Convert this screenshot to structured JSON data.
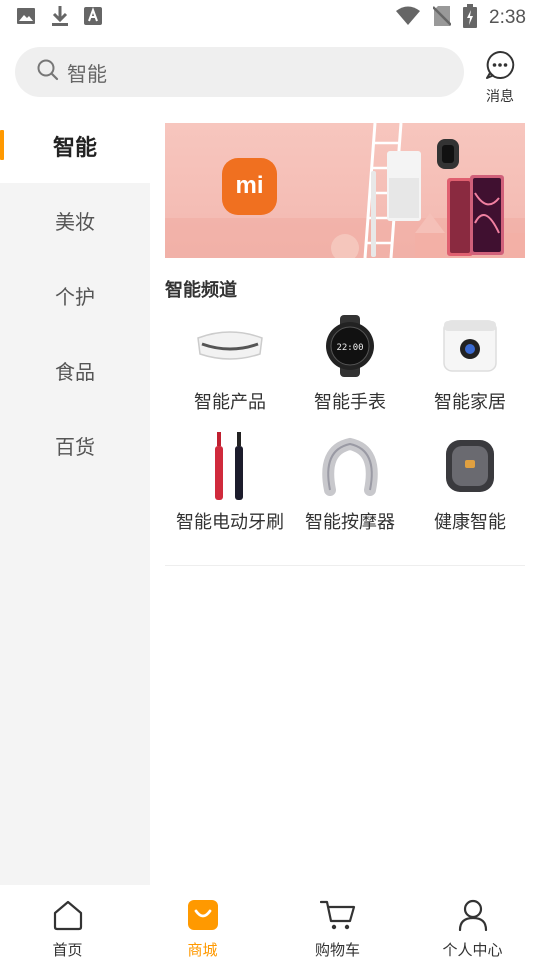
{
  "status_bar": {
    "time": "2:38",
    "icons": [
      "image-icon",
      "download-icon",
      "font-icon",
      "wifi-icon",
      "no-sim-icon",
      "battery-icon"
    ]
  },
  "header": {
    "search_text": "智能",
    "message_label": "消息"
  },
  "sidebar": {
    "items": [
      {
        "label": "智能",
        "active": true
      },
      {
        "label": "美妆",
        "active": false
      },
      {
        "label": "个护",
        "active": false
      },
      {
        "label": "食品",
        "active": false
      },
      {
        "label": "百货",
        "active": false
      }
    ]
  },
  "main": {
    "banner_logo_text": "mi",
    "section_title": "智能频道",
    "products": [
      {
        "label": "智能产品",
        "icon": "eye-massager-icon"
      },
      {
        "label": "智能手表",
        "icon": "smartwatch-icon"
      },
      {
        "label": "智能家居",
        "icon": "smart-cooker-icon"
      },
      {
        "label": "智能电动牙刷",
        "icon": "electric-toothbrush-icon"
      },
      {
        "label": "智能按摩器",
        "icon": "neck-massager-icon"
      },
      {
        "label": "健康智能",
        "icon": "foot-massager-icon"
      }
    ]
  },
  "bottom_nav": {
    "items": [
      {
        "label": "首页",
        "icon": "home-icon",
        "active": false
      },
      {
        "label": "商城",
        "icon": "shop-icon",
        "active": true
      },
      {
        "label": "购物车",
        "icon": "cart-icon",
        "active": false
      },
      {
        "label": "个人中心",
        "icon": "user-icon",
        "active": false
      }
    ]
  },
  "colors": {
    "accent": "#ff9900",
    "banner_bg": "#f5c0b8",
    "mi_orange": "#f07020"
  }
}
